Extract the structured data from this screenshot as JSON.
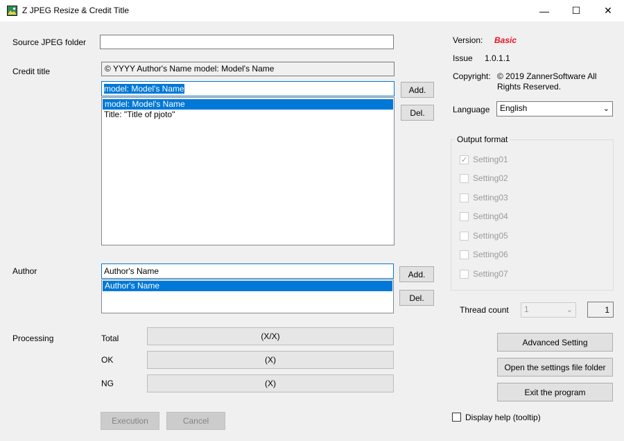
{
  "window": {
    "title": "Z JPEG Resize & Credit Title",
    "minimize": "—",
    "maximize": "☐",
    "close": "✕"
  },
  "source": {
    "label": "Source JPEG folder",
    "value": ""
  },
  "credit": {
    "label": "Credit title",
    "preview": "© YYYY Author's Name model: Model's Name",
    "input": "model: Model's Name",
    "items": [
      "model: Model's Name",
      "Title: \"Title of pjoto\""
    ],
    "add": "Add.",
    "del": "Del."
  },
  "author": {
    "label": "Author",
    "input": "Author's Name",
    "items": [
      "Author's Name"
    ],
    "add": "Add.",
    "del": "Del."
  },
  "processing": {
    "label": "Processing",
    "rows": [
      {
        "label": "Total",
        "value": "(X/X)"
      },
      {
        "label": "OK",
        "value": "(X)"
      },
      {
        "label": "NG",
        "value": "(X)"
      }
    ]
  },
  "actions": {
    "execution": "Execution",
    "cancel": "Cancel"
  },
  "info": {
    "version_label": "Version:",
    "version_value": "Basic",
    "version_color": "#e81123",
    "issue_label": "Issue",
    "issue_value": "1.0.1.1",
    "copyright_label": "Copyright:",
    "copyright_line1": "© 2019 ZannerSoftware All",
    "copyright_line2": "Rights Reserved."
  },
  "language": {
    "label": "Language",
    "value": "English"
  },
  "output": {
    "title": "Output format",
    "settings": [
      {
        "label": "Setting01",
        "checked": true
      },
      {
        "label": "Setting02",
        "checked": false
      },
      {
        "label": "Setting03",
        "checked": false
      },
      {
        "label": "Setting04",
        "checked": false
      },
      {
        "label": "Setting05",
        "checked": false
      },
      {
        "label": "Setting06",
        "checked": false
      },
      {
        "label": "Setting07",
        "checked": false
      }
    ]
  },
  "thread": {
    "label": "Thread count",
    "combo_value": "1",
    "count": "1"
  },
  "buttons": {
    "advanced": "Advanced Setting",
    "open_folder": "Open the settings file folder",
    "exit": "Exit the program"
  },
  "help": {
    "label": "Display help (tooltip)",
    "checked": false
  },
  "colors": {
    "accent": "#0078d7"
  }
}
